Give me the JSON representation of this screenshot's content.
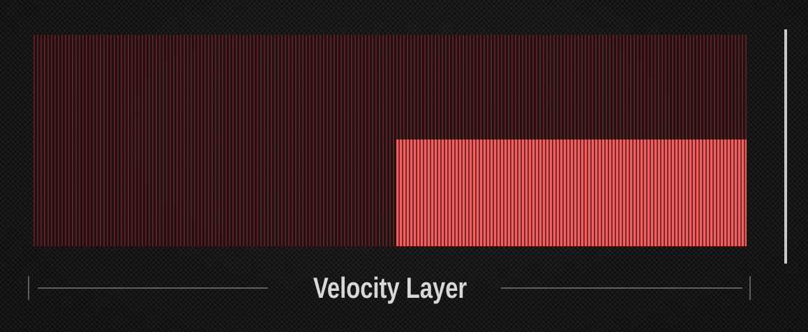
{
  "velocity_layer": {
    "label": "Velocity Layer",
    "active_segment": {
      "start_fraction": 0.509,
      "end_fraction": 1.0,
      "level_fraction": 0.505
    }
  },
  "colors": {
    "background": "#151515",
    "inactive_stripe": "#5a2424",
    "active_stripe": "#f06262",
    "label": "#d8d8d8",
    "bracket": "#5e5e5e",
    "scroll_track": "#c9c9c9"
  }
}
